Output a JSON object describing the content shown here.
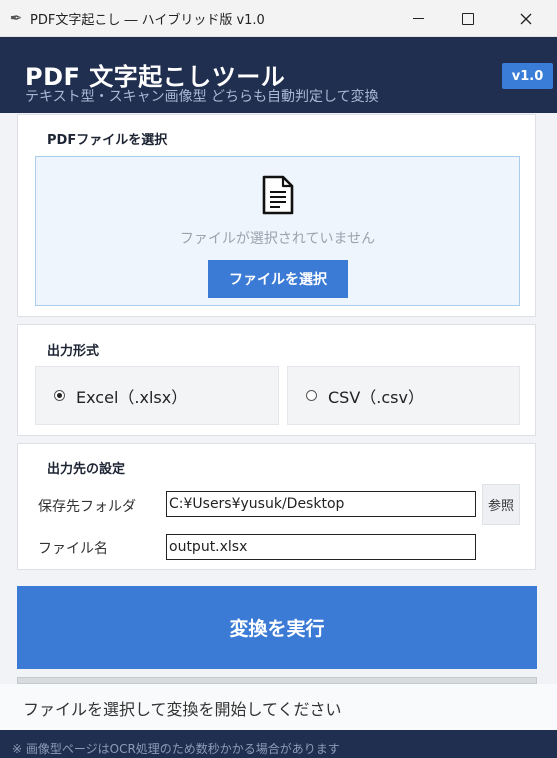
{
  "window": {
    "title": "PDF文字起こし ― ハイブリッド版 v1.0",
    "app_icon": "feather-icon"
  },
  "header": {
    "title": "PDF 文字起こしツール",
    "subtitle": "テキスト型・スキャン画像型 どちらも自動判定して変換",
    "version_badge": "v1.0"
  },
  "file_section": {
    "label": "PDFファイルを選択",
    "empty_text": "ファイルが選択されていません",
    "select_button": "ファイルを選択",
    "icon": "document-icon"
  },
  "format_section": {
    "label": "出力形式",
    "options": [
      {
        "label": "Excel（.xlsx）",
        "selected": true
      },
      {
        "label": "CSV（.csv）",
        "selected": false
      }
    ]
  },
  "output_section": {
    "label": "出力先の設定",
    "folder_label": "保存先フォルダ",
    "folder_value": "C:¥Users¥yusuk/Desktop",
    "browse_button": "参照",
    "filename_label": "ファイル名",
    "filename_value": "output.xlsx"
  },
  "convert_button": "変換を実行",
  "progress": 0,
  "status": "ファイルを選択して変換を開始してください",
  "footer_note": "※ 画像型ページはOCR処理のため数秒かかる場合があります",
  "colors": {
    "header_bg": "#202e4f",
    "accent": "#3b7bd6",
    "dropzone_bg": "#eef5fd"
  }
}
